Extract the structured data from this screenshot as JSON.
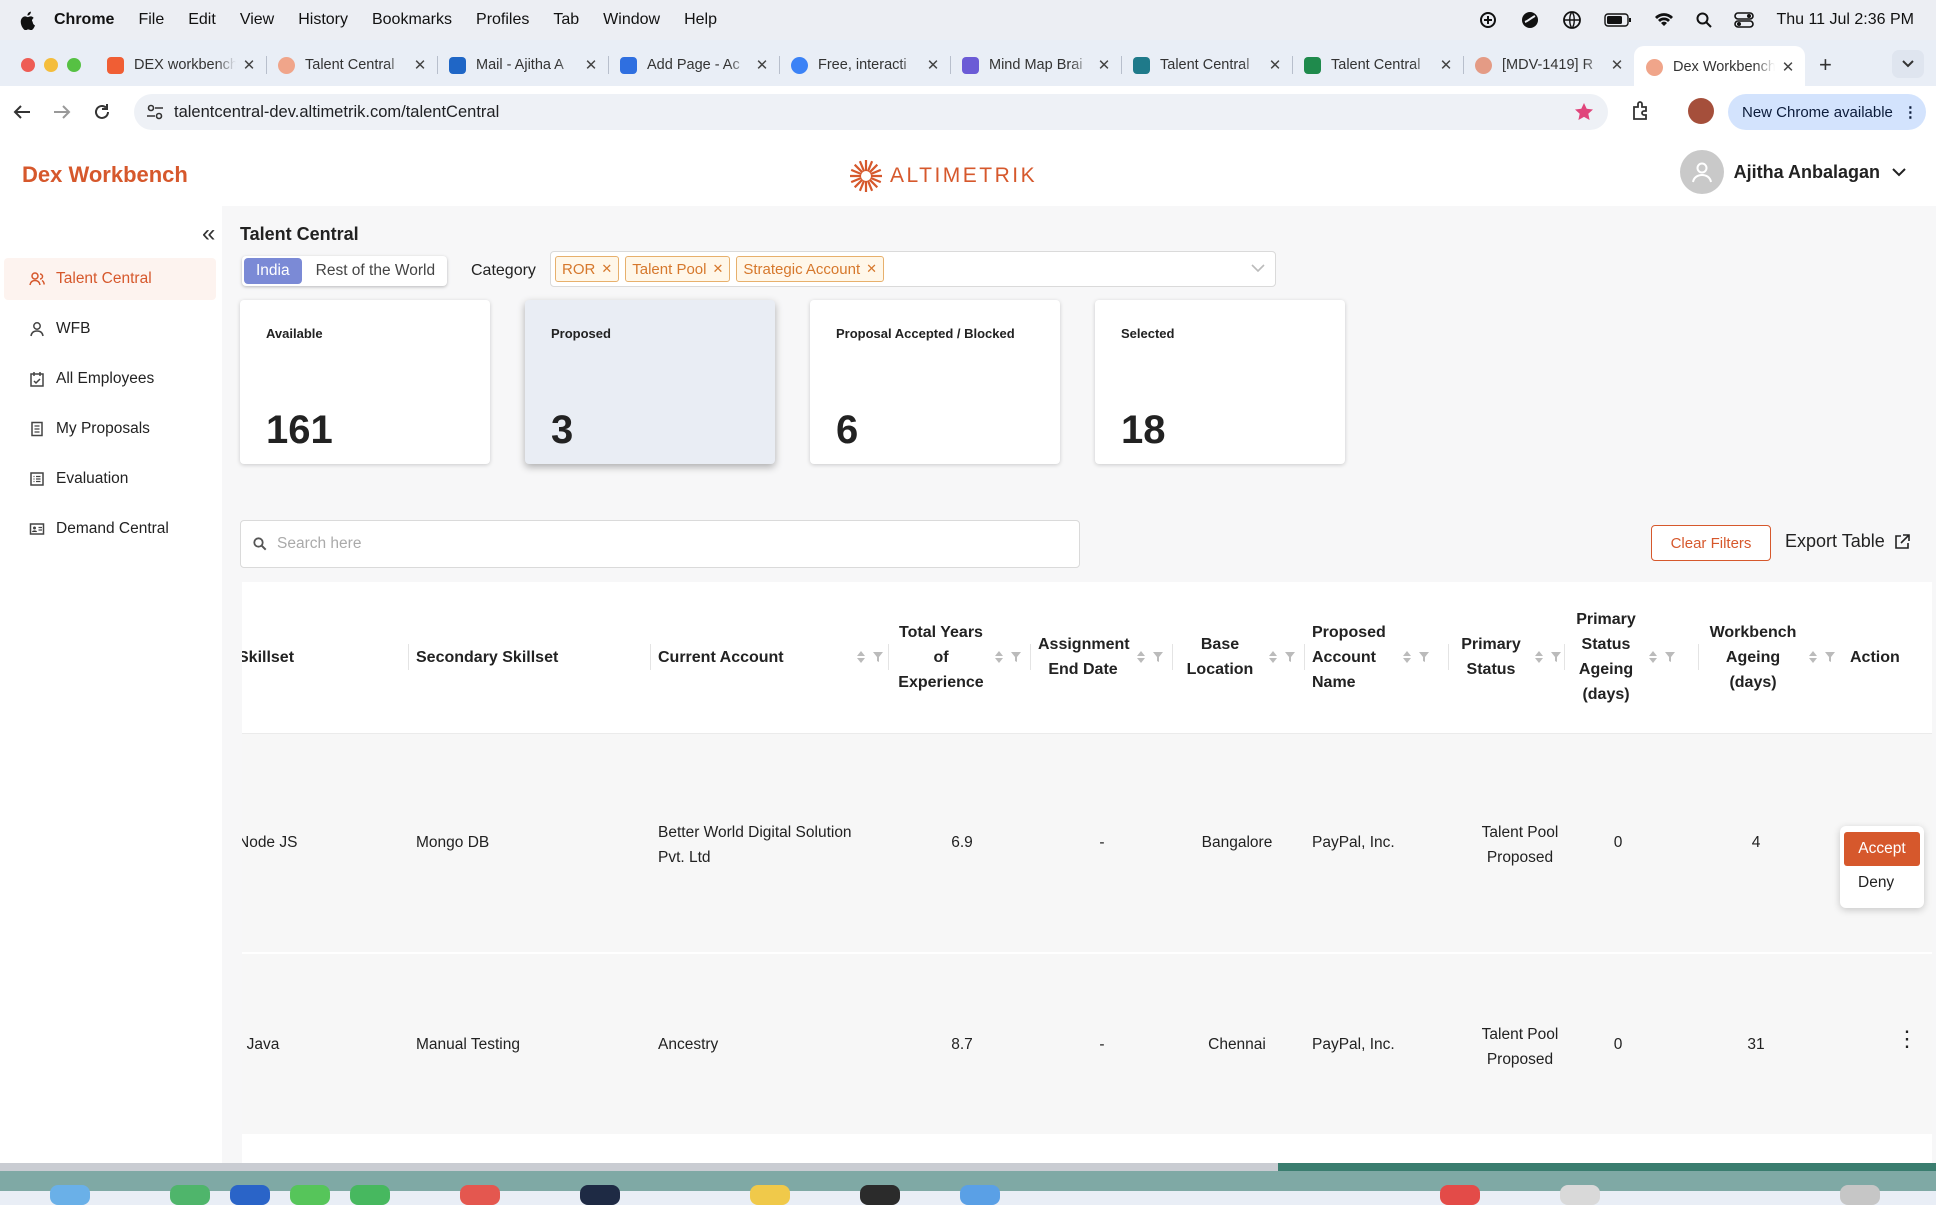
{
  "menubar": {
    "app": "Chrome",
    "items": [
      "File",
      "Edit",
      "View",
      "History",
      "Bookmarks",
      "Profiles",
      "Tab",
      "Window",
      "Help"
    ],
    "clock": "Thu 11 Jul  2:36 PM"
  },
  "tabs": [
    {
      "title": "DEX workbench",
      "color": "#f05e34"
    },
    {
      "title": "Talent Central",
      "color": "#f0a58a"
    },
    {
      "title": "Mail - Ajitha A",
      "color": "#1f66c6"
    },
    {
      "title": "Add Page - Ac",
      "color": "#2f6fe0"
    },
    {
      "title": "Free, interacti",
      "color": "#3b82f6"
    },
    {
      "title": "Mind Map Brai",
      "color": "#6b5bd6"
    },
    {
      "title": "Talent Central",
      "color": "#1f7a8a"
    },
    {
      "title": "Talent Central",
      "color": "#1f8a4c"
    },
    {
      "title": "[MDV-1419] R",
      "color": "#e49b85"
    },
    {
      "title": "Dex Workbench",
      "color": "#f0a58a",
      "active": true
    }
  ],
  "browser": {
    "url": "talentcentral-dev.altimetrik.com/talentCentral",
    "update_label": "New Chrome available"
  },
  "header": {
    "brand": "Dex Workbench",
    "logo_text": "ALTIMETRIK",
    "user_name": "Ajitha Anbalagan"
  },
  "sidebar": {
    "items": [
      {
        "label": "Talent Central",
        "icon": "people-icon",
        "active": true
      },
      {
        "label": "WFB",
        "icon": "person-icon"
      },
      {
        "label": "All Employees",
        "icon": "calendar-icon"
      },
      {
        "label": "My Proposals",
        "icon": "document-icon"
      },
      {
        "label": "Evaluation",
        "icon": "list-icon"
      },
      {
        "label": "Demand Central",
        "icon": "id-card-icon"
      }
    ]
  },
  "page": {
    "title": "Talent Central",
    "region_toggle": [
      "India",
      "Rest of the World"
    ],
    "category_label": "Category",
    "category_chips": [
      "ROR",
      "Talent Pool",
      "Strategic Account"
    ],
    "cards": [
      {
        "label": "Available",
        "value": "161"
      },
      {
        "label": "Proposed",
        "value": "3",
        "selected": true
      },
      {
        "label": "Proposal Accepted / Blocked",
        "value": "6"
      },
      {
        "label": "Selected",
        "value": "18"
      }
    ],
    "search_placeholder": "Search here",
    "clear_filters": "Clear Filters",
    "export_table": "Export Table"
  },
  "table": {
    "columns": [
      "Skillset",
      "Secondary Skillset",
      "Current Account",
      "Total Years of Experience",
      "Assignment End Date",
      "Base Location",
      "Proposed Account Name",
      "Primary Status",
      "Primary Status Ageing (days)",
      "Workbench Ageing (days)",
      "Action"
    ],
    "rows": [
      {
        "skillset": "Node JS",
        "secondary": "Mongo DB",
        "account": "Better World Digital Solution Pvt. Ltd",
        "experience": "6.9",
        "end_date": "-",
        "location": "Bangalore",
        "proposed_account": "PayPal, Inc.",
        "status": "Talent Pool Proposed",
        "status_ageing": "0",
        "wb_ageing": "4"
      },
      {
        "skillset": ", Java",
        "secondary": "Manual Testing",
        "account": "Ancestry",
        "experience": "8.7",
        "end_date": "-",
        "location": "Chennai",
        "proposed_account": "PayPal, Inc.",
        "status": "Talent Pool Proposed",
        "status_ageing": "0",
        "wb_ageing": "31"
      }
    ],
    "action_menu": [
      "Accept",
      "Deny"
    ]
  },
  "colors": {
    "brand": "#d6582c",
    "toggle_active": "#7b8ad6",
    "chip_border": "#e7b06c"
  }
}
